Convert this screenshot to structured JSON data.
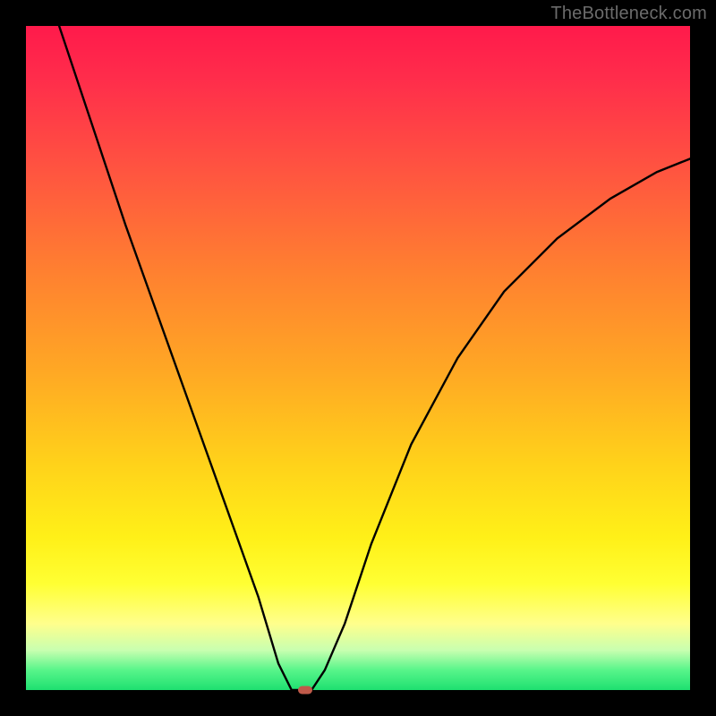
{
  "watermark": "TheBottleneck.com",
  "chart_data": {
    "type": "line",
    "title": "",
    "xlabel": "",
    "ylabel": "",
    "xlim": [
      0,
      100
    ],
    "ylim": [
      0,
      100
    ],
    "grid": false,
    "legend": false,
    "series": [
      {
        "name": "bottleneck-curve",
        "color": "#000000",
        "x": [
          5,
          10,
          15,
          20,
          25,
          30,
          35,
          38,
          40,
          41,
          42,
          43,
          45,
          48,
          52,
          58,
          65,
          72,
          80,
          88,
          95,
          100
        ],
        "y": [
          100,
          85,
          70,
          56,
          42,
          28,
          14,
          4,
          0,
          0,
          0,
          0,
          3,
          10,
          22,
          37,
          50,
          60,
          68,
          74,
          78,
          80
        ]
      }
    ],
    "marker": {
      "x": 42,
      "y": 0,
      "color": "#c05a4a"
    },
    "background": {
      "type": "vertical-gradient",
      "stops": [
        {
          "pos": 0,
          "color": "#ff1a4b"
        },
        {
          "pos": 22,
          "color": "#ff5540"
        },
        {
          "pos": 52,
          "color": "#ffa824"
        },
        {
          "pos": 77,
          "color": "#fff018"
        },
        {
          "pos": 94,
          "color": "#c8ffb0"
        },
        {
          "pos": 100,
          "color": "#1ee070"
        }
      ]
    }
  }
}
